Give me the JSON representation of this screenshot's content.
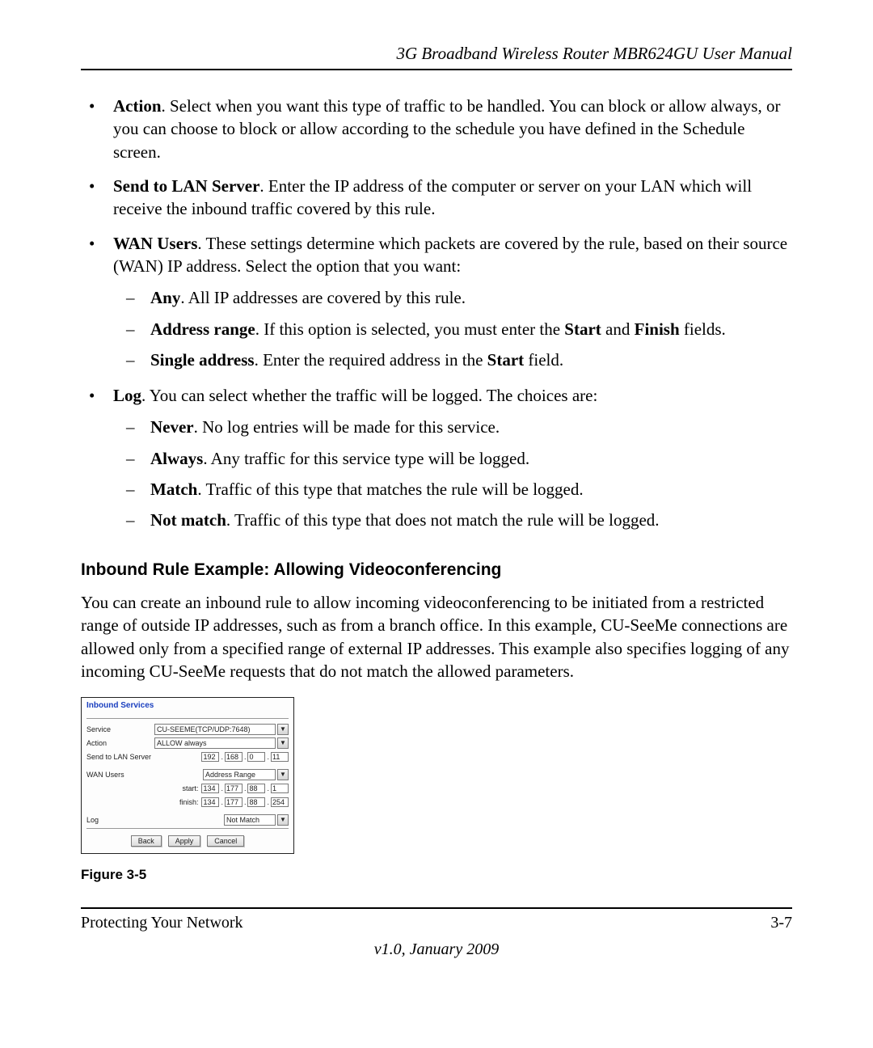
{
  "header": {
    "running_head": "3G Broadband Wireless Router MBR624GU User Manual"
  },
  "bullets": {
    "action": {
      "term": "Action",
      "text": ". Select when you want this type of traffic to be handled. You can block or allow always, or you can choose to block or allow according to the schedule you have defined in the Schedule screen."
    },
    "send_lan": {
      "term": "Send to LAN Server",
      "text": ". Enter the IP address of the computer or server on your LAN which will receive the inbound traffic covered by this rule."
    },
    "wan": {
      "term": "WAN Users",
      "text": ". These settings determine which packets are covered by the rule, based on their source (WAN) IP address. Select the option that you want:",
      "subs": {
        "any": {
          "term": "Any",
          "text": ". All IP addresses are covered by this rule."
        },
        "range": {
          "term": "Address range",
          "text_a": ". If this option is selected, you must enter the ",
          "start": "Start",
          "mid": " and ",
          "finish": "Finish",
          "text_b": " fields."
        },
        "single": {
          "term": "Single address",
          "text_a": ". Enter the required address in the ",
          "start": "Start",
          "text_b": " field."
        }
      }
    },
    "log": {
      "term": "Log",
      "text": ". You can select whether the traffic will be logged. The choices are:",
      "subs": {
        "never": {
          "term": "Never",
          "text": ". No log entries will be made for this service."
        },
        "always": {
          "term": "Always",
          "text": ". Any traffic for this service type will be logged."
        },
        "match": {
          "term": "Match",
          "text": ". Traffic of this type that matches the rule will be logged."
        },
        "notmatch": {
          "term": "Not match",
          "text": ". Traffic of this type that does not match the rule will be logged."
        }
      }
    }
  },
  "section": {
    "heading": "Inbound Rule Example: Allowing Videoconferencing",
    "para": "You can create an inbound rule to allow incoming videoconferencing to be initiated from a restricted range of outside IP addresses, such as from a branch office. In this example, CU-SeeMe connections are allowed only from a specified range of external IP addresses. This example also specifies logging of any incoming CU-SeeMe requests that do not match the allowed parameters."
  },
  "figure": {
    "panel_title": "Inbound Services",
    "labels": {
      "service": "Service",
      "action": "Action",
      "send_lan": "Send to LAN Server",
      "wan_users": "WAN Users",
      "start": "start:",
      "finish": "finish:",
      "log": "Log"
    },
    "values": {
      "service": "CU-SEEME(TCP/UDP:7648)",
      "action": "ALLOW always",
      "lan_ip": [
        "192",
        "168",
        "0",
        "11"
      ],
      "wan_mode": "Address Range",
      "start_ip": [
        "134",
        "177",
        "88",
        "1"
      ],
      "finish_ip": [
        "134",
        "177",
        "88",
        "254"
      ],
      "log": "Not Match"
    },
    "buttons": {
      "back": "Back",
      "apply": "Apply",
      "cancel": "Cancel"
    },
    "caption": "Figure 3-5"
  },
  "footer": {
    "left": "Protecting Your Network",
    "right": "3-7",
    "version": "v1.0, January 2009"
  }
}
